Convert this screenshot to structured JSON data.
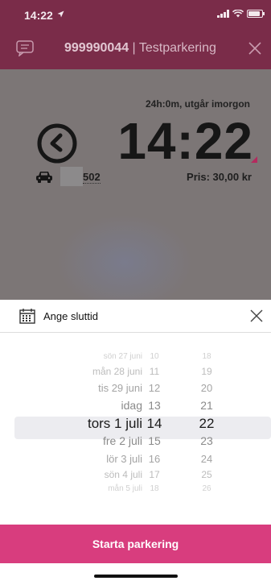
{
  "status_bar": {
    "time": "14:22"
  },
  "header": {
    "parking_id": "999990044",
    "separator": " | ",
    "zone_name": "Testparkering"
  },
  "parking": {
    "duration_text": "24h:0m, utgår imorgon",
    "end_time": "14:22",
    "plate_suffix": "502",
    "price_text": "Pris: 30,00 kr"
  },
  "sheet": {
    "title": "Ange sluttid"
  },
  "picker": {
    "dates": [
      "sön 27 juni",
      "mån 28 juni",
      "tis 29 juni",
      "idag",
      "tors 1 juli",
      "fre 2 juli",
      "lör 3 juli",
      "sön 4 juli",
      "mån 5 juli"
    ],
    "hours": [
      "10",
      "11",
      "12",
      "13",
      "14",
      "15",
      "16",
      "17",
      "18"
    ],
    "minutes": [
      "18",
      "19",
      "20",
      "21",
      "22",
      "23",
      "24",
      "25",
      "26"
    ],
    "selected_index": 4
  },
  "cta": {
    "label": "Starta parkering"
  },
  "colors": {
    "accent": "#d83d7e",
    "header": "#7a2c49"
  }
}
